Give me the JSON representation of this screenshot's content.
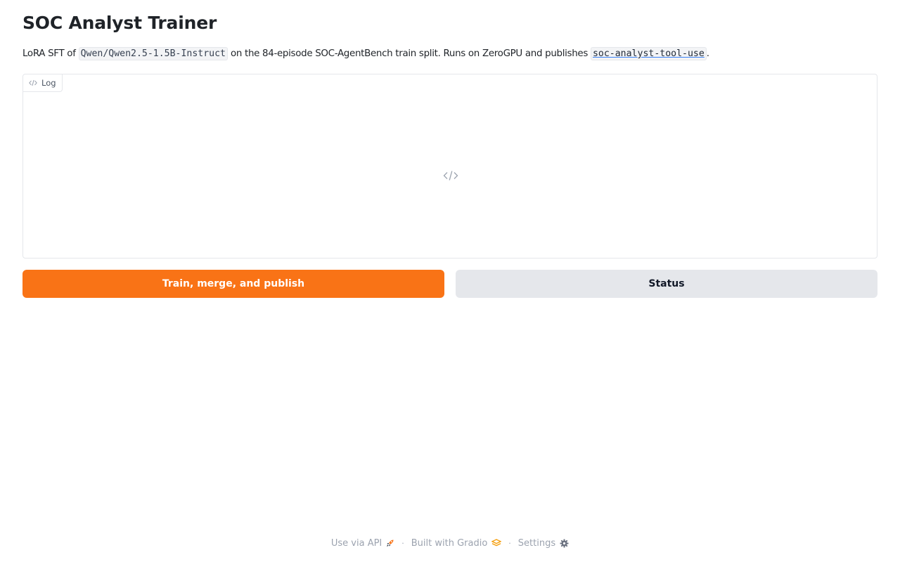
{
  "header": {
    "title": "SOC Analyst Trainer"
  },
  "description": {
    "prefix": "LoRA SFT of ",
    "model_code": "Qwen/Qwen2.5-1.5B-Instruct",
    "middle": " on the 84-episode SOC-AgentBench train split. Runs on ZeroGPU and publishes ",
    "output_code": "soc-analyst-tool-use",
    "suffix": "."
  },
  "log": {
    "label": "Log",
    "label_icon": "code-icon",
    "empty_icon": "code-icon"
  },
  "actions": {
    "train_label": "Train, merge, and publish",
    "status_label": "Status"
  },
  "footer": {
    "api_label": "Use via API",
    "api_icon": "rocket-icon",
    "built_label": "Built with Gradio",
    "built_icon": "gradio-logo-icon",
    "settings_label": "Settings",
    "settings_icon": "gear-icon",
    "separator": "·"
  },
  "colors": {
    "accent": "#f97316",
    "secondary_button": "#e5e7eb",
    "border": "#e5e7eb"
  }
}
